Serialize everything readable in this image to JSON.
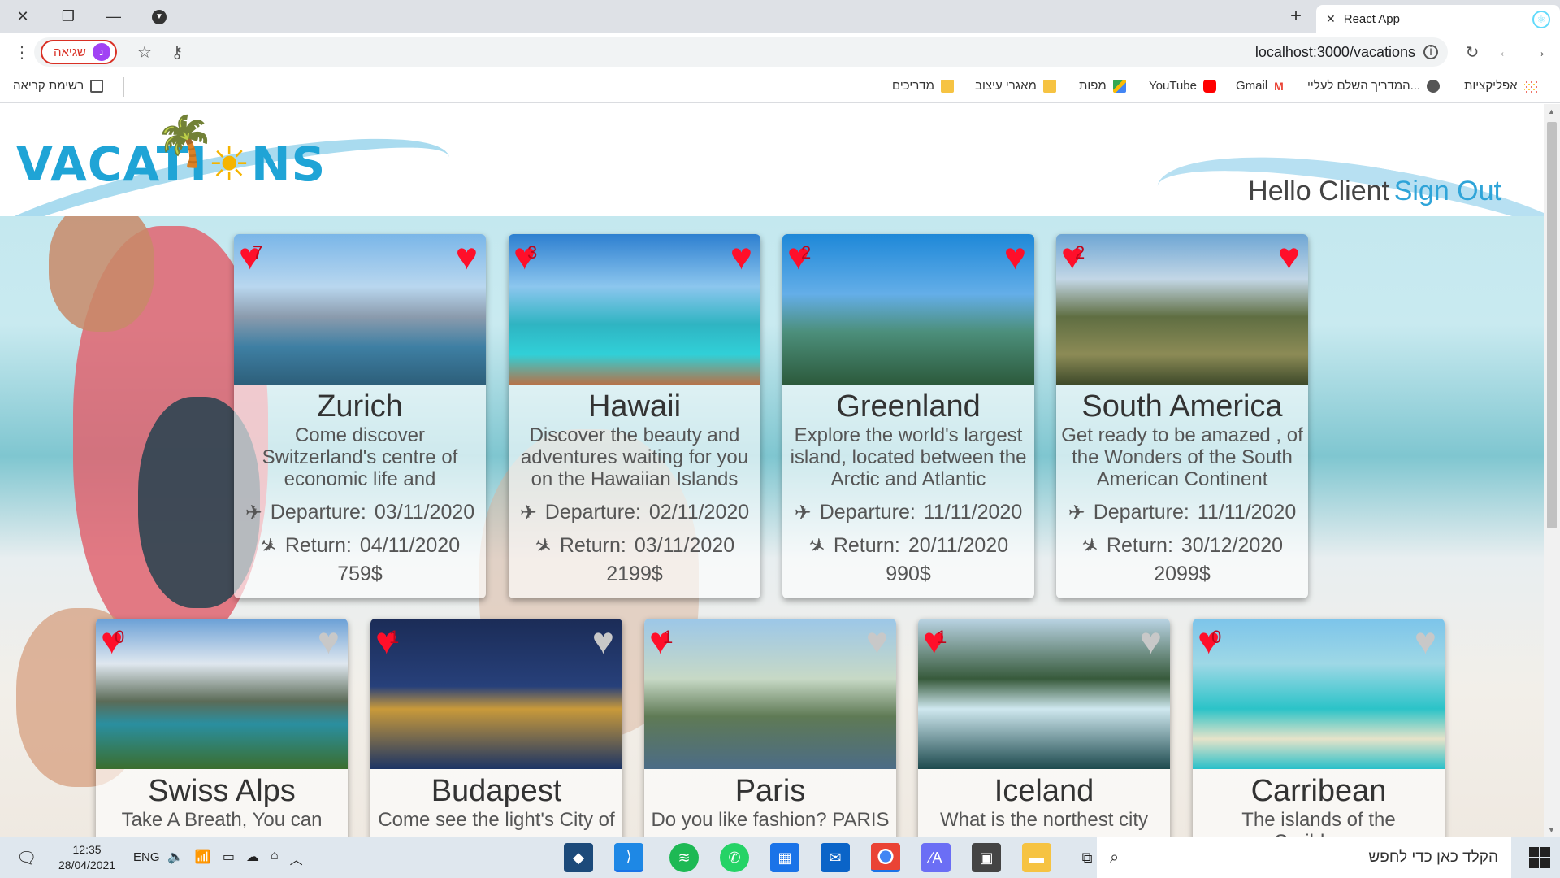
{
  "browser": {
    "tab_title": "React App",
    "new_tab_icon": "plus-icon",
    "url": "localhost:3000/vacations",
    "error_chip_label": "שגיאה",
    "profile_initial": "נ",
    "bookmarks": [
      {
        "label": "אפליקציות",
        "icon": "apps-icon"
      },
      {
        "label": "המדריך השלם לעליי...",
        "icon": "globe-icon"
      },
      {
        "label": "Gmail",
        "icon": "gmail-icon"
      },
      {
        "label": "YouTube",
        "icon": "youtube-icon"
      },
      {
        "label": "מפות",
        "icon": "maps-icon"
      },
      {
        "label": "מאגרי עיצוב",
        "icon": "folder-icon"
      },
      {
        "label": "מדריכים",
        "icon": "folder-icon"
      }
    ],
    "reading_list": "רשימת קריאה"
  },
  "app": {
    "logo_text": "VACATI  NS",
    "greeting": "Hello Client",
    "sign_out": "Sign Out",
    "colors": {
      "accent": "#2fa4d8",
      "heart": "#ff0f2a",
      "heart_inactive": "#c8c8c8"
    }
  },
  "vacations": [
    {
      "title": "Zurich",
      "description": "Come discover Switzerland's centre of economic life and education.",
      "departure_label": "Departure:",
      "departure": "03/11/2020",
      "return_label": "Return:",
      "return": "04/11/2020",
      "price": "759$",
      "followers": "7",
      "followed": true
    },
    {
      "title": "Hawaii",
      "description": "Discover the beauty and adventures waiting for you on the Hawaiian Islands",
      "departure_label": "Departure:",
      "departure": "02/11/2020",
      "return_label": "Return:",
      "return": "03/11/2020",
      "price": "2199$",
      "followers": "3",
      "followed": true
    },
    {
      "title": "Greenland",
      "description": "Explore the world's largest island, located between the Arctic and Atlantic",
      "departure_label": "Departure:",
      "departure": "11/11/2020",
      "return_label": "Return:",
      "return": "20/11/2020",
      "price": "990$",
      "followers": "2",
      "followed": true
    },
    {
      "title": "South America",
      "description": "Get ready to be amazed , of the Wonders of the South American Continent",
      "departure_label": "Departure:",
      "departure": "11/11/2020",
      "return_label": "Return:",
      "return": "30/12/2020",
      "price": "2099$",
      "followers": "2",
      "followed": true
    },
    {
      "title": "Swiss Alps",
      "description": "Take A Breath, You can",
      "followers": "0",
      "followed": false
    },
    {
      "title": "Budapest",
      "description": "Come see the light's City of",
      "followers": "1",
      "followed": false
    },
    {
      "title": "Paris",
      "description": "Do you like fashion? PARIS ,",
      "followers": "1",
      "followed": false
    },
    {
      "title": "Iceland",
      "description": "What is the northest city you",
      "followers": "1",
      "followed": false
    },
    {
      "title": "Carribean",
      "description": "The islands of the Caribbean",
      "followers": "0",
      "followed": false
    }
  ],
  "taskbar": {
    "search_placeholder": "הקלד כאן כדי לחפש",
    "time": "12:35",
    "date": "28/04/2021",
    "language": "ENG"
  }
}
